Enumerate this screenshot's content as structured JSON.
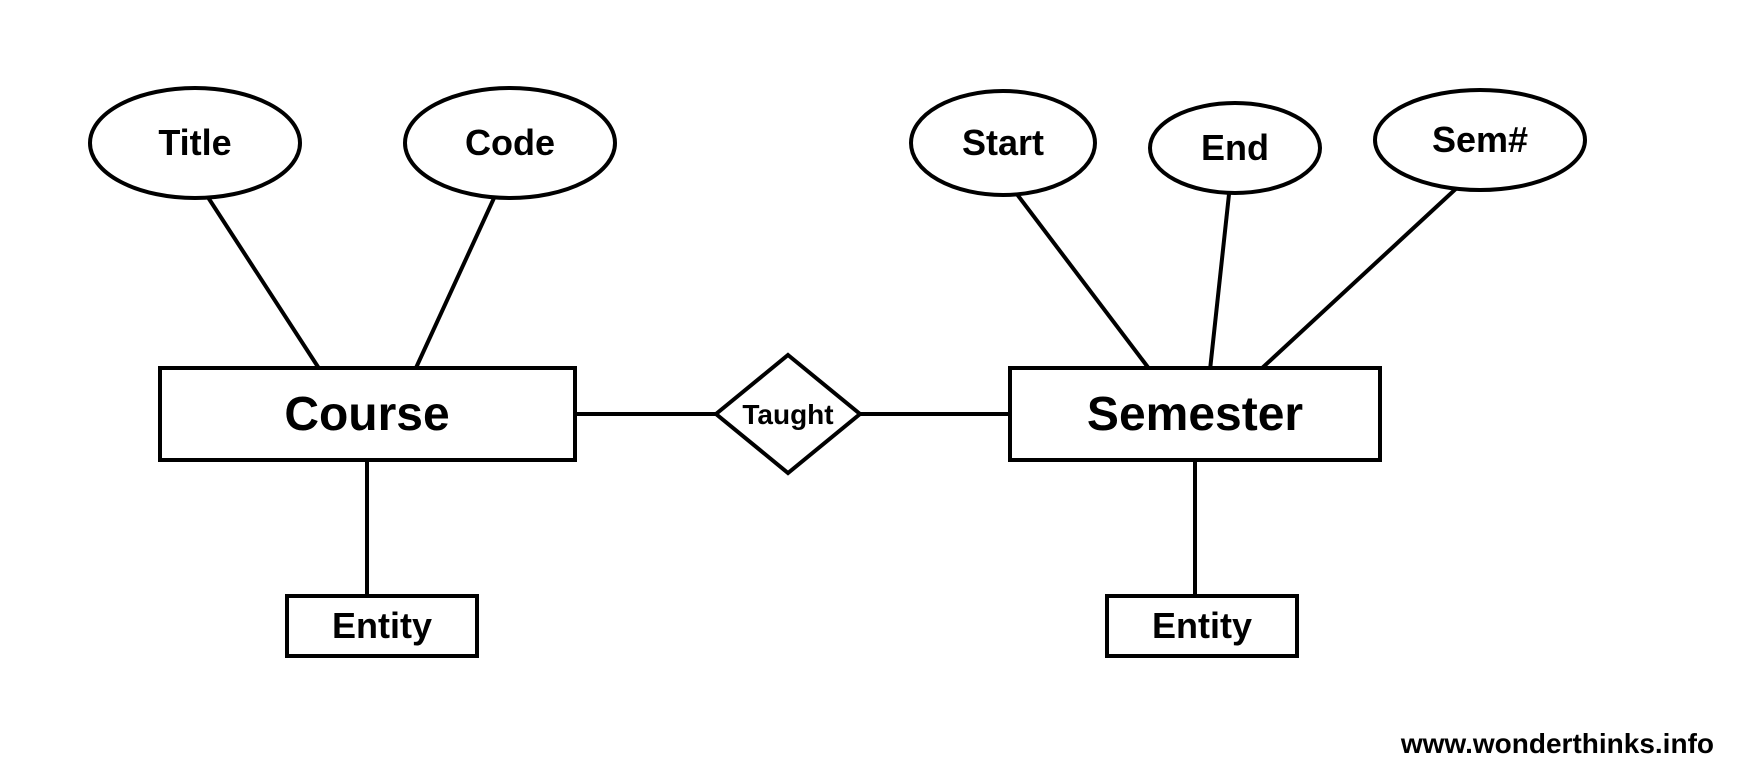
{
  "diagram": {
    "type": "entity-relationship",
    "entities": [
      {
        "name": "Course",
        "label": "Entity",
        "attributes": [
          "Title",
          "Code"
        ]
      },
      {
        "name": "Semester",
        "label": "Entity",
        "attributes": [
          "Start",
          "End",
          "Sem#"
        ]
      }
    ],
    "relationships": [
      {
        "name": "Taught",
        "between": [
          "Course",
          "Semester"
        ]
      }
    ]
  },
  "nodes": {
    "title": "Title",
    "code": "Code",
    "course": "Course",
    "taught": "Taught",
    "semester": "Semester",
    "start": "Start",
    "end": "End",
    "semnum": "Sem#",
    "entity1": "Entity",
    "entity2": "Entity"
  },
  "watermark": "www.wonderthinks.info"
}
